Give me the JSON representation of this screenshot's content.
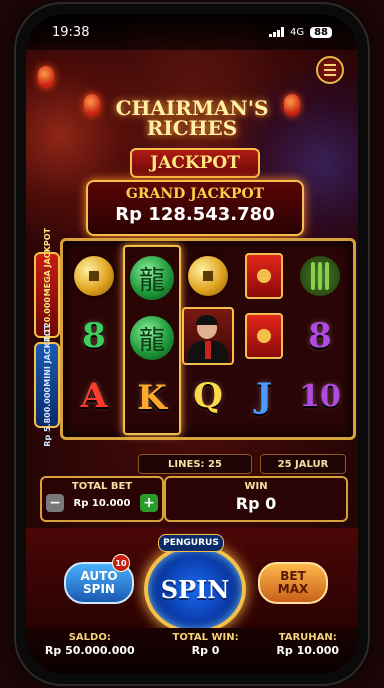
{
  "status_bar": {
    "time": "19:38",
    "network": "4G",
    "battery": "88"
  },
  "game": {
    "title_line1": "CHAIRMAN'S",
    "title_line2": "RICHES",
    "jackpot_label": "JACKPOT",
    "grand_jackpot_label": "GRAND JACKPOT",
    "grand_jackpot_value": "Rp 128.543.780",
    "mega_jackpot_label": "MEGA JACKPOT",
    "mega_jackpot_value": "Rp 24.120.000",
    "mini_jackpot_label": "MINI JACKPOT",
    "mini_jackpot_value": "Rp 5.800.000"
  },
  "reels": [
    [
      "coin",
      "8",
      "A"
    ],
    [
      "dragon",
      "dragon",
      "K"
    ],
    [
      "coin",
      "portrait",
      "Q"
    ],
    [
      "envelope",
      "envelope",
      "J"
    ],
    [
      "bamboo",
      "8",
      "10"
    ]
  ],
  "info": {
    "lines": "LINES: 25",
    "jalur": "25 JALUR"
  },
  "bet": {
    "label": "TOTAL BET",
    "value": "Rp 10.000",
    "minus": "−",
    "plus": "+"
  },
  "win": {
    "label": "WIN",
    "value": "Rp 0"
  },
  "controls": {
    "auto_line1": "AUTO",
    "auto_line2": "SPIN",
    "auto_count": "10",
    "pengurus": "PENGURUS",
    "spin": "SPIN",
    "max_line1": "BET",
    "max_line2": "MAX"
  },
  "footer": {
    "saldo_label": "SALDO:",
    "saldo_value": "Rp 50.000.000",
    "total_win_label": "TOTAL WIN:",
    "total_win_value": "Rp 0",
    "taruhan_label": "TARUHAN:",
    "taruhan_value": "Rp 10.000"
  },
  "colors": {
    "gold": "#f5c04a",
    "red": "#c81e10",
    "blue": "#1a6af0",
    "dark_red": "#3a0808"
  }
}
